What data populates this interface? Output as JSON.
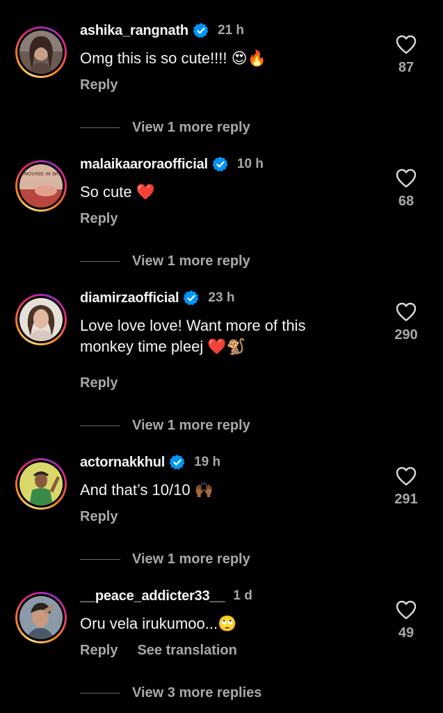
{
  "comments": [
    {
      "username": "ashika_rangnath",
      "verified": true,
      "time": "21 h",
      "text": "Omg this is so cute!!!! ",
      "emoji": "😍🔥",
      "reply_label": "Reply",
      "likes": "87",
      "view_more": "View 1 more reply"
    },
    {
      "username": "malaikaaroraofficial",
      "verified": true,
      "time": "10 h",
      "text": "So cute ",
      "emoji": "❤️",
      "reply_label": "Reply",
      "likes": "68",
      "view_more": "View 1 more reply",
      "avatar_text": "MOVING IN WITH MALAIKA"
    },
    {
      "username": "diamirzaofficial",
      "verified": true,
      "time": "23 h",
      "text": "Love love love! Want more of this monkey time pleej ",
      "emoji": "❤️🐒",
      "reply_label": "Reply",
      "likes": "290",
      "view_more": "View 1 more reply"
    },
    {
      "username": "actornakkhul",
      "verified": true,
      "time": "19 h",
      "text": "And that’s 10/10 ",
      "emoji": "🙌🏾",
      "reply_label": "Reply",
      "likes": "291",
      "view_more": "View 1 more reply"
    },
    {
      "username": "__peace_addicter33__",
      "verified": false,
      "time": "1 d",
      "text": "Oru vela irukumoo...",
      "emoji": "🙄",
      "reply_label": "Reply",
      "translate_label": "See translation",
      "likes": "49",
      "view_more": "View 3 more replies"
    }
  ],
  "icons": {
    "verified": "verified-badge-icon",
    "like": "heart-outline-icon"
  },
  "colors": {
    "background": "#000000",
    "text": "#f5f5f5",
    "secondary": "#a8a8a8",
    "verified": "#0095f6"
  }
}
